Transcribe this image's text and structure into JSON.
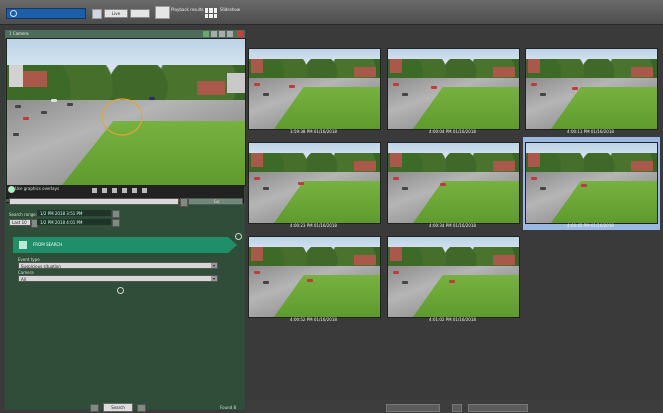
{
  "toolbar": {
    "search_placeholder": "",
    "live_button": "Live",
    "tile_label_1": "Playback results",
    "tile_label_2": "Timeline",
    "tile_label_3": "Slideshow"
  },
  "camera": {
    "title": "1 Camera"
  },
  "search_panel": {
    "checkbox_label": "Use graphics overlays",
    "dropdown_value": "",
    "go_label": "Go",
    "search_range_label": "Search range:",
    "from_value": "1/2 PM 2018  3:51 PM",
    "to_value": "1/2 PM 2018  4:01 PM",
    "mode_value": "Last 10",
    "banner_label": "FROM SEARCH",
    "event_type_label": "Event type",
    "event_type_value": "Suspicious situation",
    "camera_label": "Camera",
    "camera_value": "All",
    "footer_button": "Search",
    "footer_right": "Found 8"
  },
  "results": [
    {
      "caption": "3:59:38 PM 01/16/2018"
    },
    {
      "caption": "4:00:04 PM 01/16/2018"
    },
    {
      "caption": "4:00:11 PM 01/16/2018"
    },
    {
      "caption": "4:00:23 PM 01/16/2018"
    },
    {
      "caption": "4:00:34 PM 01/16/2018"
    },
    {
      "caption": "4:00:45 PM 01/16/2018"
    },
    {
      "caption": "4:00:52 PM 01/16/2018"
    },
    {
      "caption": "4:01:02 PM 01/16/2018"
    }
  ],
  "selected_index": 5,
  "colors": {
    "toolbar_blue": "#1c5fa8",
    "panel_green": "#2f4d39",
    "banner_green": "#1f8f6a",
    "selection_blue": "#9bb8e3",
    "trail_orange": "#e5a33c"
  },
  "icons": {
    "search": "search-icon",
    "grid": "grid-icon",
    "info": "info-icon",
    "close": "close-icon"
  }
}
